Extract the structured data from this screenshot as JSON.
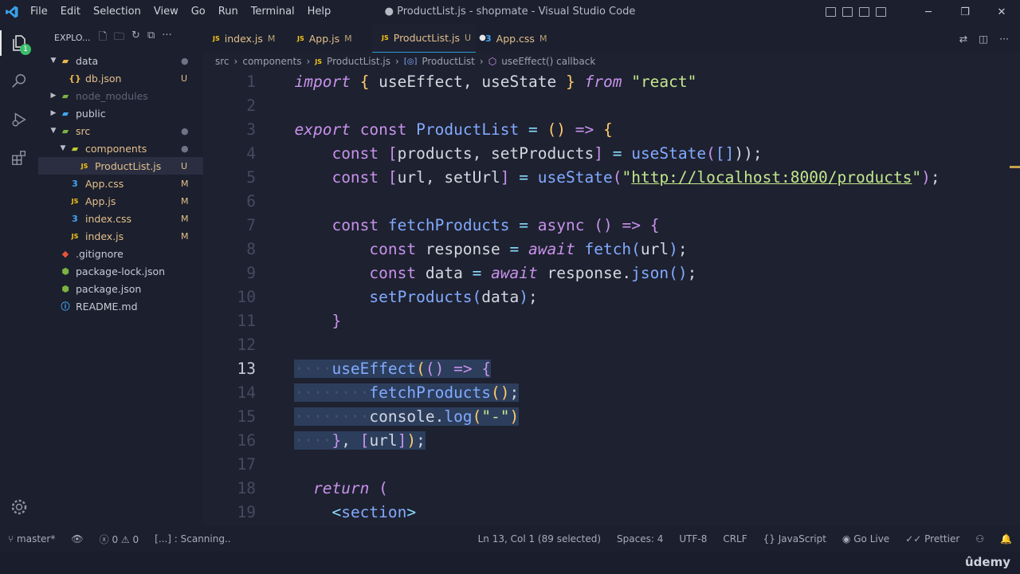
{
  "title": {
    "window_title": "● ProductList.js - shopmate - Visual Studio Code",
    "menus": [
      "File",
      "Edit",
      "Selection",
      "View",
      "Go",
      "Run",
      "Terminal",
      "Help"
    ]
  },
  "activity": {
    "scm_badge": "1"
  },
  "sidebar": {
    "header": "EXPLO...",
    "files": [
      {
        "name": "data",
        "status": "●",
        "type": "folder",
        "open": true,
        "depth": 0,
        "color": "#c8cbd6",
        "icon_color": "#e8b84a"
      },
      {
        "name": "db.json",
        "status": "U",
        "type": "json",
        "depth": 1,
        "color": "#e2c08d",
        "icon_color": "#e8b84a"
      },
      {
        "name": "node_modules",
        "status": "",
        "type": "folder",
        "open": false,
        "depth": 0,
        "color": "#5f6477",
        "icon_color": "#7cb342"
      },
      {
        "name": "public",
        "status": "",
        "type": "folder",
        "open": false,
        "depth": 0,
        "color": "#c8cbd6",
        "icon_color": "#42a5f5"
      },
      {
        "name": "src",
        "status": "●",
        "type": "folder",
        "open": true,
        "depth": 0,
        "color": "#e2c08d",
        "icon_color": "#7cb342"
      },
      {
        "name": "components",
        "status": "●",
        "type": "folder",
        "open": true,
        "depth": 1,
        "color": "#e2c08d",
        "icon_color": "#c0ca33"
      },
      {
        "name": "ProductList.js",
        "status": "U",
        "type": "js",
        "depth": 2,
        "color": "#e2c08d",
        "icon_color": "#f5c518",
        "selected": true
      },
      {
        "name": "App.css",
        "status": "M",
        "type": "css",
        "depth": 1,
        "color": "#e2c08d",
        "icon_color": "#42a5f5"
      },
      {
        "name": "App.js",
        "status": "M",
        "type": "js",
        "depth": 1,
        "color": "#e2c08d",
        "icon_color": "#f5c518"
      },
      {
        "name": "index.css",
        "status": "M",
        "type": "css",
        "depth": 1,
        "color": "#e2c08d",
        "icon_color": "#42a5f5"
      },
      {
        "name": "index.js",
        "status": "M",
        "type": "js",
        "depth": 1,
        "color": "#e2c08d",
        "icon_color": "#f5c518"
      },
      {
        "name": ".gitignore",
        "status": "",
        "type": "git",
        "depth": 0,
        "color": "#c8cbd6",
        "icon_color": "#e8553a"
      },
      {
        "name": "package-lock.json",
        "status": "",
        "type": "npm",
        "depth": 0,
        "color": "#c8cbd6",
        "icon_color": "#7cb342"
      },
      {
        "name": "package.json",
        "status": "",
        "type": "npm",
        "depth": 0,
        "color": "#c8cbd6",
        "icon_color": "#7cb342"
      },
      {
        "name": "README.md",
        "status": "",
        "type": "info",
        "depth": 0,
        "color": "#c8cbd6",
        "icon_color": "#42a5f5"
      }
    ]
  },
  "tabs": [
    {
      "name": "index.js",
      "status": "M",
      "type": "js",
      "active": false,
      "icon_color": "#f5c518"
    },
    {
      "name": "App.js",
      "status": "M",
      "type": "js",
      "active": false,
      "icon_color": "#f5c518"
    },
    {
      "name": "ProductList.js",
      "status": "U",
      "type": "js",
      "active": true,
      "dirty": true,
      "icon_color": "#f5c518"
    },
    {
      "name": "App.css",
      "status": "M",
      "type": "css",
      "active": false,
      "icon_color": "#42a5f5"
    }
  ],
  "breadcrumbs": [
    "src",
    "components",
    "ProductList.js",
    "ProductList",
    "useEffect() callback"
  ],
  "code": {
    "current_line": 13,
    "lines": [
      {
        "n": "1",
        "t": [
          [
            "  ",
            ""
          ],
          [
            "import",
            "kw"
          ],
          [
            " ",
            ""
          ],
          [
            "{",
            "pn"
          ],
          [
            " useEffect, useState ",
            ""
          ],
          [
            "}",
            "pn"
          ],
          [
            " ",
            ""
          ],
          [
            "from",
            "kw"
          ],
          [
            " ",
            ""
          ],
          [
            "\"react\"",
            "str"
          ]
        ]
      },
      {
        "n": "2",
        "t": []
      },
      {
        "n": "3",
        "t": [
          [
            "  ",
            ""
          ],
          [
            "export",
            "kw"
          ],
          [
            " ",
            ""
          ],
          [
            "const",
            "kw2"
          ],
          [
            " ",
            ""
          ],
          [
            "ProductList",
            "fn"
          ],
          [
            " ",
            ""
          ],
          [
            "=",
            "op"
          ],
          [
            " ",
            ""
          ],
          [
            "()",
            "pn"
          ],
          [
            " ",
            ""
          ],
          [
            "=>",
            "kw2"
          ],
          [
            " ",
            ""
          ],
          [
            "{",
            "pn"
          ]
        ]
      },
      {
        "n": "4",
        "t": [
          [
            "      ",
            ""
          ],
          [
            "const",
            "kw2"
          ],
          [
            " ",
            ""
          ],
          [
            "[",
            "kw2"
          ],
          [
            "products, setProducts",
            ""
          ],
          [
            "]",
            "kw2"
          ],
          [
            " ",
            ""
          ],
          [
            "=",
            "op"
          ],
          [
            " ",
            ""
          ],
          [
            "useState",
            "fn"
          ],
          [
            "(",
            "kw2"
          ],
          [
            "[]",
            "fn"
          ],
          [
            "))",
            ""
          ],
          [
            ";",
            ""
          ]
        ]
      },
      {
        "n": "5",
        "t": [
          [
            "      ",
            ""
          ],
          [
            "const",
            "kw2"
          ],
          [
            " ",
            ""
          ],
          [
            "[",
            "kw2"
          ],
          [
            "url, setUrl",
            ""
          ],
          [
            "]",
            "kw2"
          ],
          [
            " ",
            ""
          ],
          [
            "=",
            "op"
          ],
          [
            " ",
            ""
          ],
          [
            "useState",
            "fn"
          ],
          [
            "(",
            "kw2"
          ],
          [
            "\"",
            "str"
          ],
          [
            "http://localhost:8000/products",
            "url"
          ],
          [
            "\"",
            "str"
          ],
          [
            ")",
            "kw2"
          ],
          [
            ";",
            ""
          ]
        ]
      },
      {
        "n": "6",
        "t": []
      },
      {
        "n": "7",
        "t": [
          [
            "      ",
            ""
          ],
          [
            "const",
            "kw2"
          ],
          [
            " ",
            ""
          ],
          [
            "fetchProducts",
            "fn"
          ],
          [
            " ",
            ""
          ],
          [
            "=",
            "op"
          ],
          [
            " ",
            ""
          ],
          [
            "async",
            "kw2"
          ],
          [
            " ",
            ""
          ],
          [
            "()",
            "kw2"
          ],
          [
            " ",
            ""
          ],
          [
            "=>",
            "kw2"
          ],
          [
            " ",
            ""
          ],
          [
            "{",
            "kw2"
          ]
        ]
      },
      {
        "n": "8",
        "t": [
          [
            "          ",
            ""
          ],
          [
            "const",
            "kw2"
          ],
          [
            " response ",
            ""
          ],
          [
            "=",
            "op"
          ],
          [
            " ",
            ""
          ],
          [
            "await",
            "kw"
          ],
          [
            " ",
            ""
          ],
          [
            "fetch",
            "fn"
          ],
          [
            "(",
            "fn"
          ],
          [
            "url",
            ""
          ],
          [
            ")",
            "fn"
          ],
          [
            ";",
            ""
          ]
        ]
      },
      {
        "n": "9",
        "t": [
          [
            "          ",
            ""
          ],
          [
            "const",
            "kw2"
          ],
          [
            " data ",
            ""
          ],
          [
            "=",
            "op"
          ],
          [
            " ",
            ""
          ],
          [
            "await",
            "kw"
          ],
          [
            " response.",
            ""
          ],
          [
            "json",
            "fn"
          ],
          [
            "()",
            "fn"
          ],
          [
            ";",
            ""
          ]
        ]
      },
      {
        "n": "10",
        "t": [
          [
            "          ",
            ""
          ],
          [
            "setProducts",
            "fn"
          ],
          [
            "(",
            "fn"
          ],
          [
            "data",
            ""
          ],
          [
            ")",
            "fn"
          ],
          [
            ";",
            ""
          ]
        ]
      },
      {
        "n": "11",
        "t": [
          [
            "      ",
            ""
          ],
          [
            "}",
            "kw2"
          ]
        ]
      },
      {
        "n": "12",
        "t": []
      },
      {
        "n": "13",
        "sel": true,
        "t": [
          [
            "  ",
            ""
          ],
          [
            "····",
            "ws"
          ],
          [
            "useEffect",
            "fn"
          ],
          [
            "(",
            "pn"
          ],
          [
            "()",
            "kw2"
          ],
          [
            " ",
            ""
          ],
          [
            "=>",
            "kw2"
          ],
          [
            " ",
            ""
          ],
          [
            "{",
            "kw2"
          ]
        ]
      },
      {
        "n": "14",
        "sel": true,
        "t": [
          [
            "  ",
            ""
          ],
          [
            "········",
            "ws"
          ],
          [
            "fetchProducts",
            "fn"
          ],
          [
            "()",
            "pn"
          ],
          [
            ";",
            ""
          ]
        ]
      },
      {
        "n": "15",
        "sel": true,
        "t": [
          [
            "  ",
            ""
          ],
          [
            "········",
            "ws"
          ],
          [
            "console.",
            ""
          ],
          [
            "log",
            "fn"
          ],
          [
            "(",
            "pn"
          ],
          [
            "\"-\"",
            "str"
          ],
          [
            ")",
            "pn"
          ]
        ]
      },
      {
        "n": "16",
        "sel": true,
        "t": [
          [
            "  ",
            ""
          ],
          [
            "····",
            "ws"
          ],
          [
            "}",
            "kw2"
          ],
          [
            ", ",
            ""
          ],
          [
            "[",
            "kw2"
          ],
          [
            "url",
            ""
          ],
          [
            "]",
            "kw2"
          ],
          [
            ")",
            "pn"
          ],
          [
            ";",
            ""
          ]
        ]
      },
      {
        "n": "17",
        "t": []
      },
      {
        "n": "18",
        "t": [
          [
            "    ",
            ""
          ],
          [
            "return",
            "kw"
          ],
          [
            " ",
            ""
          ],
          [
            "(",
            "kw2"
          ]
        ]
      },
      {
        "n": "19",
        "t": [
          [
            "      ",
            ""
          ],
          [
            "<",
            "op"
          ],
          [
            "section",
            "fn"
          ],
          [
            ">",
            "op"
          ]
        ]
      }
    ]
  },
  "status": {
    "branch": "master*",
    "errors": "0",
    "warnings": "0",
    "scanning": "[...] : Scanning..",
    "position": "Ln 13, Col 1 (89 selected)",
    "spaces": "Spaces: 4",
    "encoding": "UTF-8",
    "eol": "CRLF",
    "language": "JavaScript",
    "golive": "Go Live",
    "prettier": "Prettier"
  },
  "watermark": "ûdemy"
}
